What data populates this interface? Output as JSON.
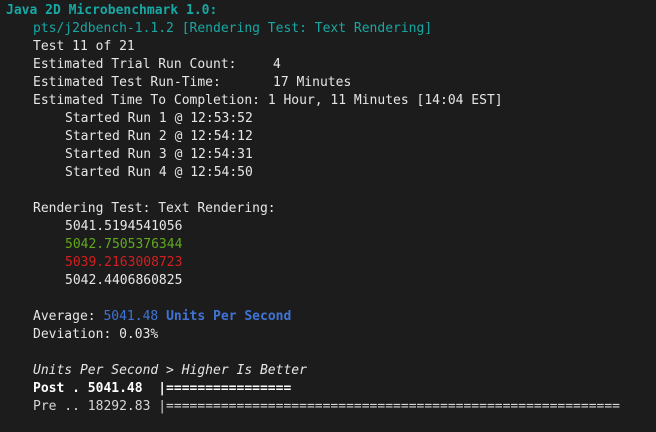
{
  "header": {
    "benchmark_title": "Java 2D Microbenchmark 1.0:",
    "test_profile": "pts/j2dbench-1.1.2 [Rendering Test: Text Rendering]"
  },
  "status": {
    "test_counter": "Test 11 of 21",
    "trial_label": "Estimated Trial Run Count:",
    "trial_value": "4",
    "runtime_label": "Estimated Test Run-Time:",
    "runtime_value": "17 Minutes",
    "completion_label": "Estimated Time To Completion:",
    "completion_value": "1 Hour, 11 Minutes [14:04 EST]"
  },
  "runs": [
    "Started Run 1 @ 12:53:52",
    "Started Run 2 @ 12:54:12",
    "Started Run 3 @ 12:54:31",
    "Started Run 4 @ 12:54:50"
  ],
  "results": {
    "heading": "Rendering Test: Text Rendering:",
    "values": [
      "5041.5194541056",
      "5042.7505376344",
      "5039.2163008723",
      "5042.4406860825"
    ],
    "colors": {
      "max": "#62a91d",
      "min": "#d31f1f",
      "accent": "#3f74d6",
      "header": "#18a8a4"
    },
    "average_label": "Average:",
    "average_value": "5041.48",
    "average_units": "Units Per Second",
    "deviation": "Deviation: 0.03%"
  },
  "comparison": {
    "direction_label": "Units Per Second > Higher Is Better",
    "rows": [
      {
        "label": "Post . 5041.48",
        "bar": "|================"
      },
      {
        "label": "Pre .. 18292.83",
        "bar": "|=========================================================="
      }
    ]
  }
}
